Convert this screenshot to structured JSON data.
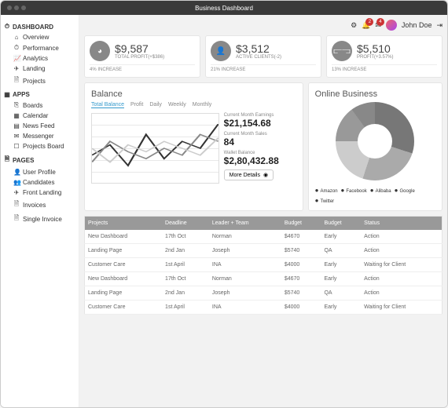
{
  "window_title": "Business Dashboard",
  "sidebar": {
    "sections": [
      {
        "title": "DASHBOARD",
        "icon": "⏱",
        "items": [
          {
            "icon": "⌂",
            "label": "Overview"
          },
          {
            "icon": "⏱",
            "label": "Performance"
          },
          {
            "icon": "📈",
            "label": "Analytics"
          },
          {
            "icon": "✈",
            "label": "Landing"
          },
          {
            "icon": "🗎",
            "label": "Projects"
          }
        ]
      },
      {
        "title": "APPS",
        "icon": "▦",
        "items": [
          {
            "icon": "⎘",
            "label": "Boards"
          },
          {
            "icon": "▦",
            "label": "Calendar"
          },
          {
            "icon": "▤",
            "label": "News Feed"
          },
          {
            "icon": "✉",
            "label": "Messenger"
          },
          {
            "icon": "☐",
            "label": "Projects Board"
          }
        ]
      },
      {
        "title": "PAGES",
        "icon": "🗎",
        "items": [
          {
            "icon": "👤",
            "label": "User Profile"
          },
          {
            "icon": "👥",
            "label": "Candidates"
          },
          {
            "icon": "✈",
            "label": "Front Landing"
          },
          {
            "icon": "🗎",
            "label": "Invoices"
          },
          {
            "icon": "🗎",
            "label": "Single Invoice"
          }
        ]
      }
    ]
  },
  "topbar": {
    "notifications_1": "2",
    "notifications_2": "4",
    "user": "John Doe"
  },
  "cards": [
    {
      "value": "$9,587",
      "label": "TOTAL PROFIT(+$386)",
      "footer": "4% INCREASE"
    },
    {
      "value": "$3,512",
      "label": "ACTIVE CLIENTS(-2)",
      "footer": "21% INCREASE"
    },
    {
      "value": "$5,510",
      "label": "PROFIT(+3.57%)",
      "footer": "13% INCREASE"
    }
  ],
  "balance": {
    "title": "Balance",
    "tabs": [
      "Total Balance",
      "Profit",
      "Daily",
      "Weekly",
      "Monthly"
    ],
    "active_tab": 0,
    "stats": [
      {
        "label": "Current Month Earnings",
        "value": "$21,154.68"
      },
      {
        "label": "Current Month Sales",
        "value": "84"
      },
      {
        "label": "Wallet Balance",
        "value": "$2,80,432.88"
      }
    ],
    "button": "More Details"
  },
  "online": {
    "title": "Online Business",
    "legend": [
      "Amazon",
      "Facebook",
      "Alibaba",
      "Google",
      "Twitter"
    ]
  },
  "chart_data": {
    "type": "line",
    "title": "Balance",
    "series": [
      {
        "name": "dark",
        "values": [
          40,
          55,
          25,
          70,
          35,
          60,
          50,
          85
        ]
      },
      {
        "name": "mid",
        "values": [
          30,
          60,
          45,
          35,
          50,
          40,
          70,
          60
        ]
      },
      {
        "name": "light",
        "values": [
          50,
          30,
          55,
          45,
          60,
          50,
          40,
          65
        ]
      }
    ],
    "ylim": [
      0,
      100
    ]
  },
  "table": {
    "headers": [
      "Projects",
      "Deadline",
      "Leader + Team",
      "Budget",
      "Budget",
      "Status"
    ],
    "rows": [
      [
        "New Dashboard",
        "17th Oct",
        "Norman",
        "$4670",
        "Early",
        "Action"
      ],
      [
        "Landing Page",
        "2nd Jan",
        "Joseph",
        "$5740",
        "QA",
        "Action"
      ],
      [
        "Customer Care",
        "1st April",
        "INA",
        "$4000",
        "Early",
        "Waiting for Client"
      ],
      [
        "New Dashboard",
        "17th Oct",
        "Norman",
        "$4670",
        "Early",
        "Action"
      ],
      [
        "Landing Page",
        "2nd Jan",
        "Joseph",
        "$5740",
        "QA",
        "Action"
      ],
      [
        "Customer Care",
        "1st April",
        "INA",
        "$4000",
        "Early",
        "Waiting for Client"
      ]
    ]
  }
}
